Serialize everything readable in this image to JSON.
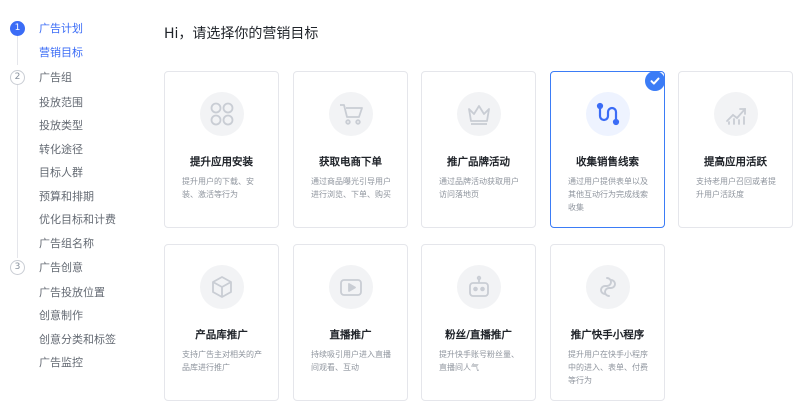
{
  "sidebar": {
    "steps": [
      {
        "number": "1",
        "label": "广告计划",
        "children": [
          "营销目标"
        ]
      },
      {
        "number": "2",
        "label": "广告组",
        "children": [
          "投放范围",
          "投放类型",
          "转化途径",
          "目标人群",
          "预算和排期",
          "优化目标和计费",
          "广告组名称"
        ]
      },
      {
        "number": "3",
        "label": "广告创意",
        "children": [
          "广告投放位置",
          "创意制作",
          "创意分类和标签",
          "广告监控"
        ]
      }
    ]
  },
  "main": {
    "heading": "Hi，请选择你的营销目标",
    "cards": [
      {
        "title": "提升应用安装",
        "desc": "提升用户的下载、安装、激活等行为",
        "icon": "app-grid-icon",
        "selected": false
      },
      {
        "title": "获取电商下单",
        "desc": "通过商品曝光引导用户进行浏览、下单、购买",
        "icon": "shopping-cart-icon",
        "selected": false
      },
      {
        "title": "推广品牌活动",
        "desc": "通过品牌活动获取用户访问落地页",
        "icon": "crown-icon",
        "selected": false
      },
      {
        "title": "收集销售线索",
        "desc": "通过用户提供表单以及其他互动行为完成线索收集",
        "icon": "lead-path-icon",
        "selected": true
      },
      {
        "title": "提高应用活跃",
        "desc": "支持老用户召回或者提升用户活跃度",
        "icon": "trend-chart-icon",
        "selected": false
      },
      {
        "title": "产品库推广",
        "desc": "支持广告主对相关的产品库进行推广",
        "icon": "cube-icon",
        "selected": false
      },
      {
        "title": "直播推广",
        "desc": "持续吸引用户进入直播间观看、互动",
        "icon": "play-icon",
        "selected": false
      },
      {
        "title": "粉丝/直播推广",
        "desc": "提升快手账号粉丝量、直播间人气",
        "icon": "robot-icon",
        "selected": false
      },
      {
        "title": "推广快手小程序",
        "desc": "提升用户在快手小程序中的进入、表单、付费等行为",
        "icon": "mini-program-icon",
        "selected": false
      }
    ]
  },
  "colors": {
    "accent": "#3b6cf6",
    "selected_border": "#3b7cf6",
    "card_border": "#e5e6eb"
  }
}
